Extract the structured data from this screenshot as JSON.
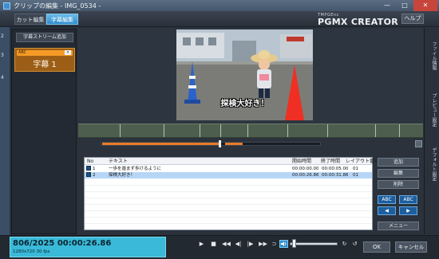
{
  "window": {
    "title": "クリップの編集 - IMG_0534 -",
    "minimize": "—",
    "maximize": "□",
    "close": "✕"
  },
  "tabs": [
    {
      "label": "カット編集",
      "active": false
    },
    {
      "label": "字幕編集",
      "active": true
    }
  ],
  "logo": {
    "brand": "TMPGEnc",
    "name": "PGMX CREATOR"
  },
  "help_label": "ヘルプ",
  "desktop_numbers": [
    "1",
    "2",
    "3",
    "4"
  ],
  "left_panel": {
    "add_stream_label": "字幕ストリーム追加",
    "track": {
      "badge": "ABC",
      "close_glyph": "×",
      "label": "字幕 1"
    }
  },
  "side_tabs": [
    "ファイル情報",
    "プレビュー設定",
    "デフォルト設定"
  ],
  "video": {
    "subtitle": "探検大好き！"
  },
  "seek": {
    "played_fraction": 0.53
  },
  "table": {
    "headers": {
      "no": "No",
      "text": "テキスト",
      "start": "開始時間",
      "end": "終了時間",
      "layout": "レイアウト番号"
    },
    "rows": [
      {
        "no": "1",
        "text": "一歩を進まず歩けるように",
        "start": "00:00:00.00",
        "end": "00:00:05.00",
        "layout": "01",
        "selected": false
      },
      {
        "no": "2",
        "text": "探検大好き！",
        "start": "00:00:26.86",
        "end": "00:00:31.86",
        "layout": "01",
        "selected": true
      }
    ]
  },
  "buttons": {
    "add": "追加",
    "edit": "編集",
    "delete": "削除",
    "menu": "メニュー",
    "abc_left": "ABC",
    "abc_right": "ABC",
    "nav_left": "◀",
    "nav_right": "▶"
  },
  "timecode": {
    "main": "806/2025  00:00:26.86",
    "sub": "1280x720 30 fps"
  },
  "transport": {
    "play": "▶",
    "stop": "■",
    "rewind": "◀◀",
    "prev_frame": "◀|",
    "next_frame": "|▶",
    "forward": "▶▶",
    "loop": "⊃",
    "repeat": "↻",
    "reset": "↺"
  },
  "volume": 0.1,
  "ok_label": "OK",
  "cancel_label": "キャンセル",
  "colors": {
    "accent": "#2f8ccc",
    "track": "#f59a26",
    "timecode_bg": "#3ab9d8",
    "cut_segment": "#ea7b27"
  }
}
